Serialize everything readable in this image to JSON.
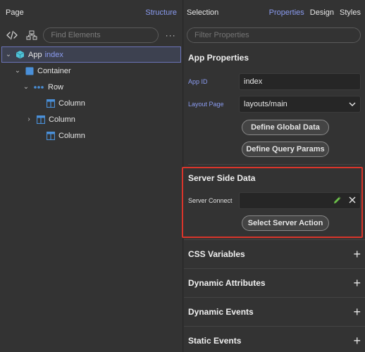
{
  "left": {
    "title": "Page",
    "structure_link": "Structure",
    "search_placeholder": "Find Elements",
    "more": "···",
    "tree": [
      {
        "label": "App",
        "sub": "index"
      },
      {
        "label": "Container"
      },
      {
        "label": "Row"
      },
      {
        "label": "Column"
      },
      {
        "label": "Column"
      },
      {
        "label": "Column"
      }
    ]
  },
  "right": {
    "title": "Selection",
    "tabs": [
      "Properties",
      "Design",
      "Styles"
    ],
    "filter_placeholder": "Filter Properties",
    "app_properties": {
      "title": "App Properties",
      "app_id_label": "App ID",
      "app_id_value": "index",
      "layout_label": "Layout Page",
      "layout_value": "layouts/main",
      "define_global": "Define Global Data",
      "define_query": "Define Query Params"
    },
    "server_side": {
      "title": "Server Side Data",
      "server_connect_label": "Server Connect",
      "select_action": "Select Server Action"
    },
    "sections": [
      "CSS Variables",
      "Dynamic Attributes",
      "Dynamic Events",
      "Static Events"
    ]
  },
  "colors": {
    "accent": "#8a9bf0",
    "highlight": "#d9352b",
    "teal_icon": "#4fc3d9",
    "blue_icon": "#4a90d9"
  }
}
